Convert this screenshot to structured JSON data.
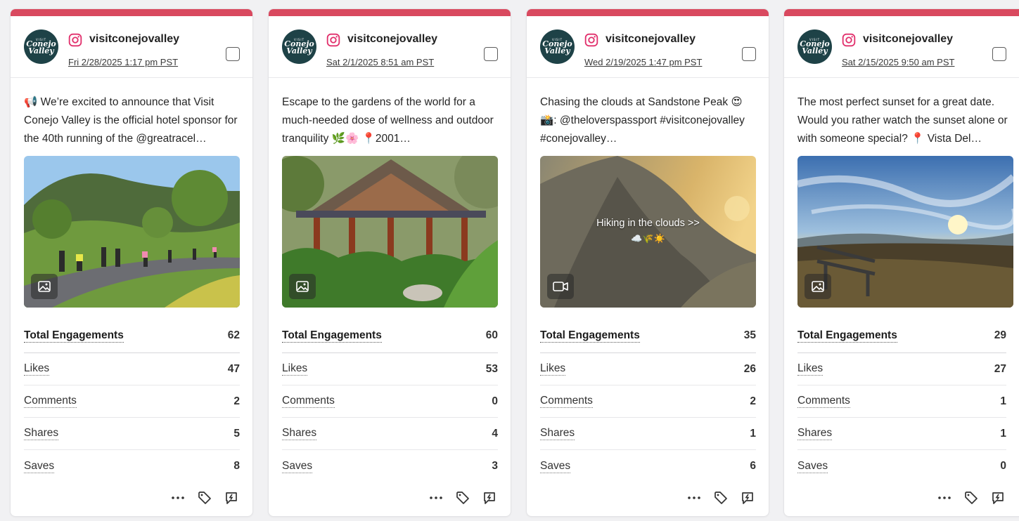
{
  "posts": [
    {
      "account": "visitconejovalley",
      "date": "Fri 2/28/2025 1:17 pm PST",
      "caption": "📢 We’re excited to announce that Visit Conejo Valley is the official hotel sponsor for the 40th running of the @greatracel…",
      "media_type": "image",
      "overlay_text": "",
      "overlay_emoji": "",
      "metrics": [
        {
          "label": "Total Engagements",
          "value": "62"
        },
        {
          "label": "Likes",
          "value": "47"
        },
        {
          "label": "Comments",
          "value": "2"
        },
        {
          "label": "Shares",
          "value": "5"
        },
        {
          "label": "Saves",
          "value": "8"
        }
      ]
    },
    {
      "account": "visitconejovalley",
      "date": "Sat 2/1/2025 8:51 am PST",
      "caption": "Escape to the gardens of the world for a much-needed dose of wellness and outdoor tranquility 🌿🌸 📍2001…",
      "media_type": "image",
      "overlay_text": "",
      "overlay_emoji": "",
      "metrics": [
        {
          "label": "Total Engagements",
          "value": "60"
        },
        {
          "label": "Likes",
          "value": "53"
        },
        {
          "label": "Comments",
          "value": "0"
        },
        {
          "label": "Shares",
          "value": "4"
        },
        {
          "label": "Saves",
          "value": "3"
        }
      ]
    },
    {
      "account": "visitconejovalley",
      "date": "Wed 2/19/2025 1:47 pm PST",
      "caption": "Chasing the clouds at Sandstone Peak 😍 📸: @theloverspassport #visitconejovalley #conejovalley…",
      "media_type": "video",
      "overlay_text": "Hiking in the clouds >>",
      "overlay_emoji": "☁️🌾☀️",
      "metrics": [
        {
          "label": "Total Engagements",
          "value": "35"
        },
        {
          "label": "Likes",
          "value": "26"
        },
        {
          "label": "Comments",
          "value": "2"
        },
        {
          "label": "Shares",
          "value": "1"
        },
        {
          "label": "Saves",
          "value": "6"
        }
      ]
    },
    {
      "account": "visitconejovalley",
      "date": "Sat 2/15/2025 9:50 am PST",
      "caption": "The most perfect sunset for a great date. Would you rather watch the sunset alone or with someone special? 📍 Vista Del…",
      "media_type": "image",
      "overlay_text": "",
      "overlay_emoji": "",
      "metrics": [
        {
          "label": "Total Engagements",
          "value": "29"
        },
        {
          "label": "Likes",
          "value": "27"
        },
        {
          "label": "Comments",
          "value": "1"
        },
        {
          "label": "Shares",
          "value": "1"
        },
        {
          "label": "Saves",
          "value": "0"
        }
      ]
    }
  ],
  "avatar_text": {
    "tiny": "VISIT",
    "line1": "Conejo",
    "line2": "Valley"
  },
  "icons": {
    "platform": "instagram-icon",
    "image_badge": "image-icon",
    "video_badge": "video-camera-icon",
    "more": "more-horizontal-icon",
    "tag": "tag-icon",
    "boost": "boost-icon"
  },
  "colors": {
    "accent_bar": "#d9495f",
    "instagram": "#e1306c",
    "avatar_bg": "#1e4247"
  }
}
